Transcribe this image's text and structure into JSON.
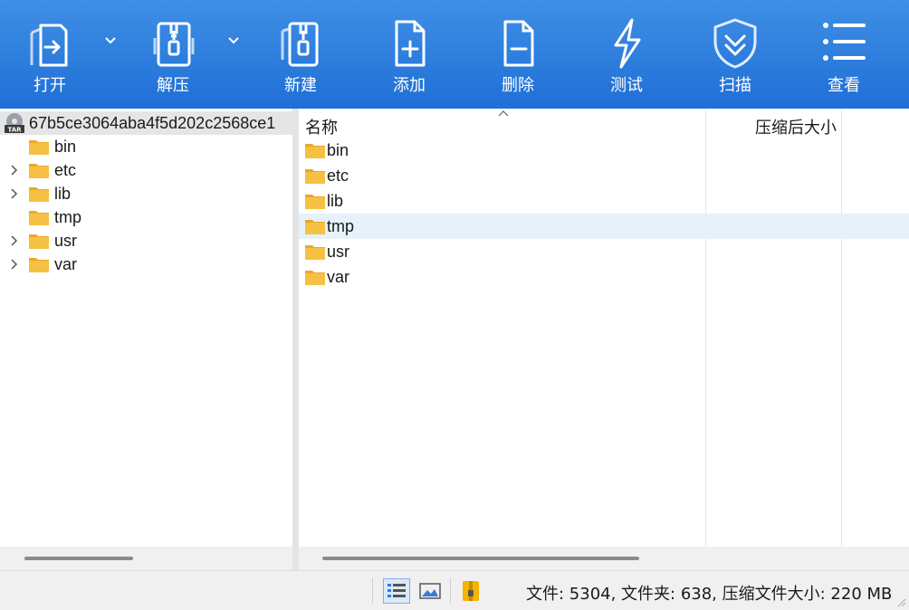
{
  "toolbar": {
    "open": "打开",
    "extract": "解压",
    "new": "新建",
    "add": "添加",
    "delete": "删除",
    "test": "测试",
    "scan": "扫描",
    "view": "查看"
  },
  "tree": {
    "root": "67b5ce3064aba4f5d202c2568ce1",
    "items": [
      {
        "label": "bin",
        "expandable": false
      },
      {
        "label": "etc",
        "expandable": true
      },
      {
        "label": "lib",
        "expandable": true
      },
      {
        "label": "tmp",
        "expandable": false
      },
      {
        "label": "usr",
        "expandable": true
      },
      {
        "label": "var",
        "expandable": true
      }
    ]
  },
  "list": {
    "col_name": "名称",
    "col_size": "压缩后大小",
    "rows": [
      "bin",
      "etc",
      "lib",
      "tmp",
      "usr",
      "var"
    ],
    "selected": "tmp"
  },
  "status": {
    "text": "文件: 5304, 文件夹: 638, 压缩文件大小: 220 MB"
  },
  "colors": {
    "toolbar": "#2b7de0",
    "selection": "#e5f1fb",
    "folder": "#f6c143"
  }
}
